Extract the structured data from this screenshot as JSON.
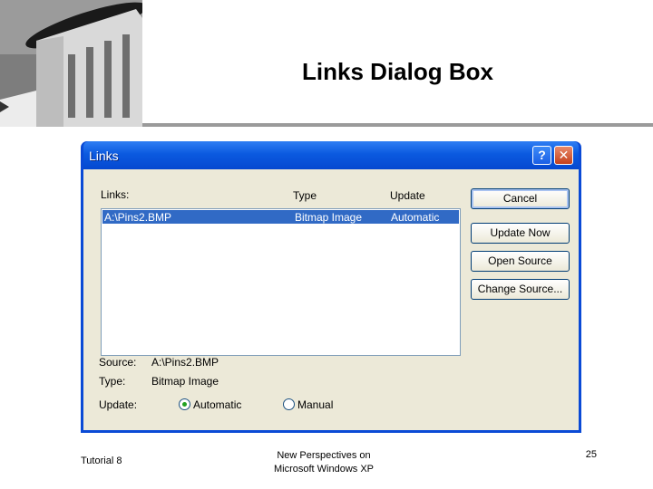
{
  "slide": {
    "title": "Links Dialog Box",
    "footer_left": "Tutorial 8",
    "footer_center_line1": "New Perspectives on",
    "footer_center_line2": "Microsoft Windows XP",
    "page_number": "25"
  },
  "dialog": {
    "title": "Links",
    "help_glyph": "?",
    "close_glyph": "✕",
    "links_label": "Links:",
    "columns": {
      "type": "Type",
      "update": "Update"
    },
    "links_rows": [
      {
        "link": "A:\\Pins2.BMP",
        "type": "Bitmap Image",
        "update": "Automatic",
        "selected": true
      }
    ],
    "buttons": {
      "cancel": "Cancel",
      "update_now": "Update Now",
      "open_source": "Open Source",
      "change_source": "Change Source..."
    },
    "source_label": "Source:",
    "source_value": "A:\\Pins2.BMP",
    "type_label": "Type:",
    "type_value": "Bitmap Image",
    "update_label": "Update:",
    "update_options": {
      "automatic": "Automatic",
      "manual": "Manual"
    },
    "update_selected": "automatic"
  },
  "colors": {
    "titlebar_blue": "#0b5ae0",
    "selection_blue": "#316ac5",
    "dialog_face": "#ece9d8",
    "radio_dot": "#21a121"
  }
}
